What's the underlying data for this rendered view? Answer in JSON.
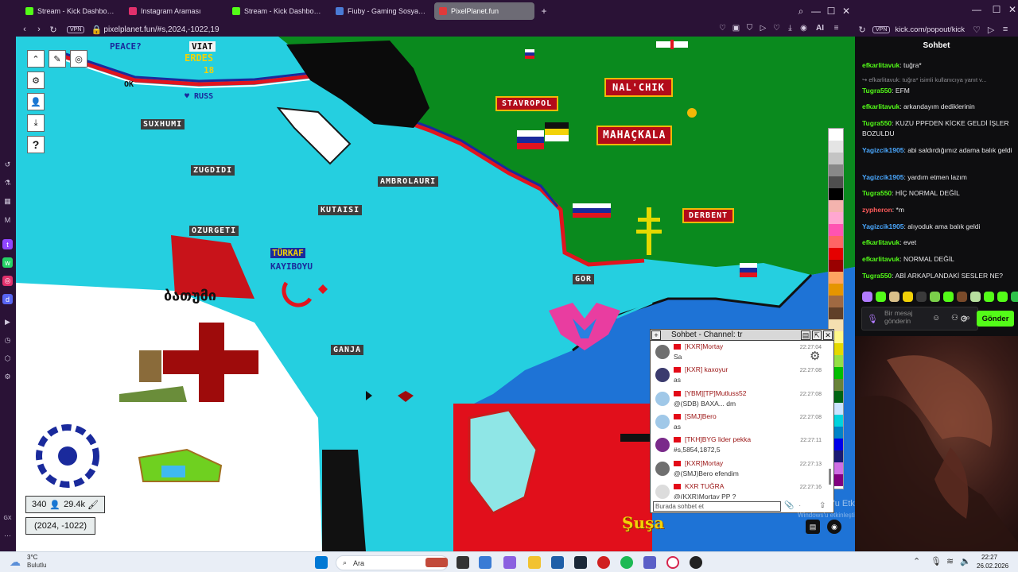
{
  "browser": {
    "tabs": [
      {
        "label": "Stream - Kick Dashboard",
        "color": "#53fc18"
      },
      {
        "label": "Instagram Araması",
        "color": "#e1306c"
      },
      {
        "label": "Stream - Kick Dashboard",
        "color": "#53fc18"
      },
      {
        "label": "Fiuby - Gaming Sosyal Me",
        "color": "#4a7bd6"
      },
      {
        "label": "PixelPlanet.fun",
        "color": "#e03a3a"
      }
    ],
    "new_tab": "+",
    "vpn": "VPN",
    "url": "pixelplanet.fun/#s,2024,-1022,19"
  },
  "map": {
    "labels": {
      "peace": "PEACE?",
      "viat": "VIAT",
      "erdes": "ERDES",
      "erdes_num": "18",
      "ok": "OK",
      "russ": "♥ RUSS",
      "sukhumi": "SUXHUMI",
      "kutaisi": "KUTAISI",
      "zugdidi": "ZUGDIDI",
      "ambrolauri": "AMBROLAURI",
      "ozurgeti": "OZURGETI",
      "turkay1": "TÜRKAF",
      "turkay2": "KAYIBOYU",
      "gor": "GOR",
      "ganja": "GANJA",
      "stavropol": "STAVROPOL",
      "nalchik": "NAL'CHIK",
      "makhachkala": "MAHAÇKALA",
      "derbent": "DERBENT",
      "shusha": "Şuşa",
      "georgia_script": "ბათუმი"
    },
    "tools": [
      "chevron-up",
      "erase",
      "settings",
      "gear",
      "user",
      "download",
      "help"
    ],
    "help_glyph": "?",
    "online_count": "340",
    "pixel_count": "29.4k",
    "coords": "(2024, -1022)",
    "palette": [
      "#ffffff",
      "#e4e4e4",
      "#c4c4c4",
      "#888888",
      "#4e4e4e",
      "#000000",
      "#f4b3ae",
      "#ffa7d1",
      "#ff54b2",
      "#ff6565",
      "#e50000",
      "#9a0000",
      "#fea460",
      "#e59500",
      "#a06a42",
      "#604028",
      "#f5dfb0",
      "#fff889",
      "#e5d900",
      "#94e044",
      "#02be01",
      "#688338",
      "#006513",
      "#cae3ff",
      "#00d3dd",
      "#0083c7",
      "#0000ea",
      "#191973",
      "#cf6ee4",
      "#820080"
    ]
  },
  "map_chat": {
    "title": "Sohbet - Channel: tr",
    "messages": [
      {
        "name": "[KXR]Mortay",
        "text": "Sa",
        "time": "22:27:04",
        "avatar": "#6f6f6f"
      },
      {
        "name": "[KXR] kaxoyur",
        "text": "as",
        "time": "22:27:08",
        "avatar": "#3b3b6e"
      },
      {
        "name": "[YBM][TP]Mutluss52",
        "text": "@(SDB) BAXA... dm",
        "time": "22:27:08",
        "avatar": "#a0c8e8"
      },
      {
        "name": "[SMJ]Bero",
        "text": "as",
        "time": "22:27:08",
        "avatar": "#a0c8e8"
      },
      {
        "name": "[TKH]BYG lider pekka",
        "text": "#s,5854,1872,5",
        "time": "22:27:11",
        "avatar": "#7a2a8a"
      },
      {
        "name": "[KXR]Mortay",
        "text": "@(SMJ)Bero efendim",
        "time": "22:27:13",
        "avatar": "#6f6f6f"
      },
      {
        "name": "KXR TUĞRA",
        "text": "@(KXR)Mortay PP ?",
        "time": "22:27:16",
        "avatar": "#dcdcdc"
      }
    ],
    "input_placeholder": "Burada sohbet et"
  },
  "kick": {
    "vpn": "VPN",
    "url": "kick.com/popout/kick",
    "title": "Sohbet",
    "messages": [
      {
        "user": "efkarlitavuk",
        "text": "tuğra*",
        "color": "#53fc18"
      },
      {
        "reply": "efkarlitavuk: tuğra* isimli kullanıcıya yanıt v..."
      },
      {
        "user": "Tugra550",
        "text": "EFM",
        "color": "#53fc18"
      },
      {
        "user": "efkarlitavuk",
        "text": "arkandayım dediklerinin",
        "color": "#53fc18"
      },
      {
        "user": "Tugra550",
        "text": "KUZU PPFDEN KİCKE GELDİ İŞLER BOZULDU",
        "color": "#53fc18"
      },
      {
        "user": "Yagizcik1905",
        "text": "abi saldırdığımız adama balık geldi",
        "color": "#4aa8ff"
      },
      {
        "user": "Yagizcik1905",
        "text": "yardım etmen lazım",
        "color": "#4aa8ff"
      },
      {
        "user": "Tugra550",
        "text": "HİÇ NORMAL DEĞİL",
        "color": "#53fc18"
      },
      {
        "user": "zypheron",
        "text": "*m",
        "color": "#ff5b5b"
      },
      {
        "user": "Yagizcik1905",
        "text": "alıyoduk ama balık geldi",
        "color": "#4aa8ff"
      },
      {
        "user": "efkarlitavuk",
        "text": "evet",
        "color": "#53fc18"
      },
      {
        "user": "efkarlitavuk",
        "text": "NORMAL DEĞİL",
        "color": "#53fc18"
      },
      {
        "user": "Tugra550",
        "text": "ABİ ARKAPLANDAKİ SESLER NE?",
        "color": "#53fc18"
      }
    ],
    "input_placeholder": "Bir mesaj gönderin",
    "send": "Gönder"
  },
  "windows_watermark": {
    "line1": "Windows'u Etkinleştir",
    "line2": "Windows'u etkinleştirmek için Ayarlar'a gidin."
  },
  "taskbar": {
    "weather_temp": "3°C",
    "weather_desc": "Bulutlu",
    "search": "Ara",
    "time": "22:27",
    "date": "26.02.2026"
  }
}
